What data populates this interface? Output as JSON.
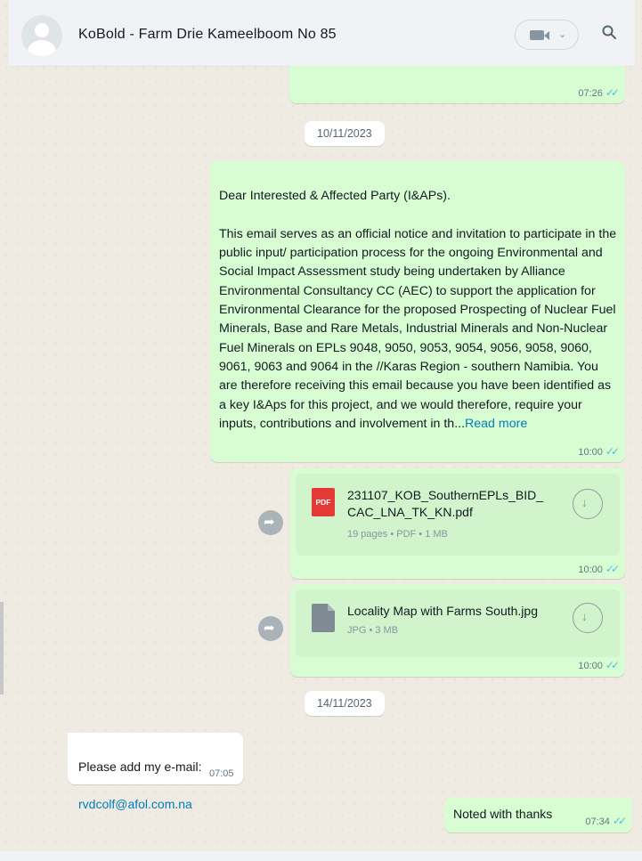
{
  "header": {
    "chat_title": "KoBold - Farm Drie Kameelboom No 85",
    "call_chevron": "⌄"
  },
  "colors": {
    "outgoing_bubble": "#d9fdd3",
    "incoming_bubble": "#ffffff",
    "read_ticks": "#53bdeb",
    "link": "#027eb5",
    "pdf_icon": "#e53935"
  },
  "messages": {
    "top_partial": {
      "time": "07:26",
      "ticks": "✓✓"
    },
    "date_1": "10/11/2023",
    "notice": {
      "text": "Dear Interested & Affected Party (I&APs).\n\nThis email serves as an official notice and invitation to participate in the public input/ participation process for the ongoing Environmental and Social Impact Assessment study being undertaken by Alliance Environmental Consultancy CC (AEC)  to support the application for Environmental Clearance for the proposed Prospecting of Nuclear Fuel Minerals, Base and Rare Metals, Industrial Minerals and Non-Nuclear Fuel Minerals on EPLs 9048, 9050, 9053, 9054, 9056, 9058, 9060, 9061, 9063 and 9064 in the //Karas Region -  southern Namibia. You are therefore receiving this email because you have been identified as a key I&Aps for this project, and we would therefore, require your inputs, contributions and involvement in th...",
      "read_more": "Read more",
      "time": "10:00",
      "ticks": "✓✓"
    },
    "doc_pdf": {
      "icon_label": "PDF",
      "name_line1": "231107_KOB_SouthernEPLs_BID_",
      "name_line2": "CAC_LNA_TK_KN.pdf",
      "info": "19 pages • PDF • 1 MB",
      "time": "10:00",
      "ticks": "✓✓"
    },
    "doc_jpg": {
      "name": "Locality Map with Farms South.jpg",
      "info": "JPG • 3 MB",
      "time": "10:00",
      "ticks": "✓✓"
    },
    "date_2": "14/11/2023",
    "incoming": {
      "line1": "Please add my e-mail:",
      "email": "rvdcolf@afol.com.na",
      "time": "07:05"
    },
    "reply": {
      "text": "Noted with thanks",
      "time": "07:34",
      "ticks": "✓✓"
    }
  }
}
